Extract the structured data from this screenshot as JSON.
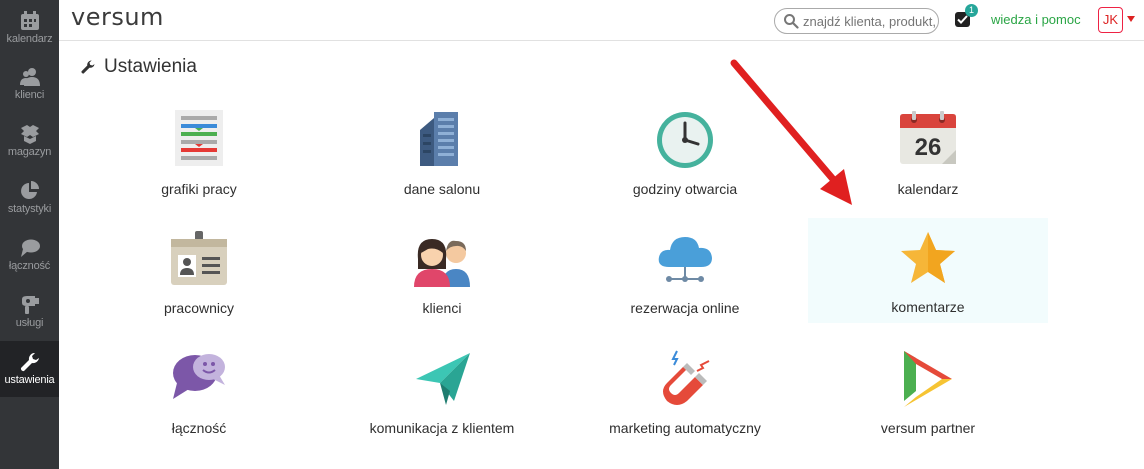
{
  "sidebar": {
    "items": [
      {
        "label": "kalendarz",
        "icon": "calendar-icon"
      },
      {
        "label": "klienci",
        "icon": "users-icon"
      },
      {
        "label": "magazyn",
        "icon": "boxes-icon"
      },
      {
        "label": "statystyki",
        "icon": "pie-chart-icon"
      },
      {
        "label": "łączność",
        "icon": "chat-icon"
      },
      {
        "label": "usługi",
        "icon": "hairdryer-icon"
      },
      {
        "label": "ustawienia",
        "icon": "wrench-icon",
        "active": true
      }
    ]
  },
  "header": {
    "logo": "versum",
    "search_placeholder": "znajdź klienta, produkt, usługę",
    "notification_count": "1",
    "help_link": "wiedza i pomoc",
    "user_initials": "JK"
  },
  "page": {
    "title": "Ustawienia"
  },
  "tiles": [
    {
      "label": "grafiki pracy",
      "icon": "schedule-chart-icon"
    },
    {
      "label": "dane salonu",
      "icon": "building-icon"
    },
    {
      "label": "godziny otwarcia",
      "icon": "clock-icon"
    },
    {
      "label": "kalendarz",
      "icon": "calendar-26-icon",
      "date_number": "26"
    },
    {
      "label": "pracownicy",
      "icon": "employee-badge-icon"
    },
    {
      "label": "klienci",
      "icon": "clients-icon"
    },
    {
      "label": "rezerwacja online",
      "icon": "cloud-icon"
    },
    {
      "label": "komentarze",
      "icon": "star-icon",
      "highlighted": true
    },
    {
      "label": "łączność",
      "icon": "chat-bubbles-icon"
    },
    {
      "label": "komunikacja z klientem",
      "icon": "paper-plane-icon"
    },
    {
      "label": "marketing automatyczny",
      "icon": "magnet-icon"
    },
    {
      "label": "versum partner",
      "icon": "partner-logo-icon"
    }
  ],
  "colors": {
    "sidebar_bg": "#333538",
    "help_link": "#2aa545",
    "user_accent": "#dd2222",
    "annotation_arrow": "#e02020",
    "highlight_bg": "#f2fcfd"
  }
}
